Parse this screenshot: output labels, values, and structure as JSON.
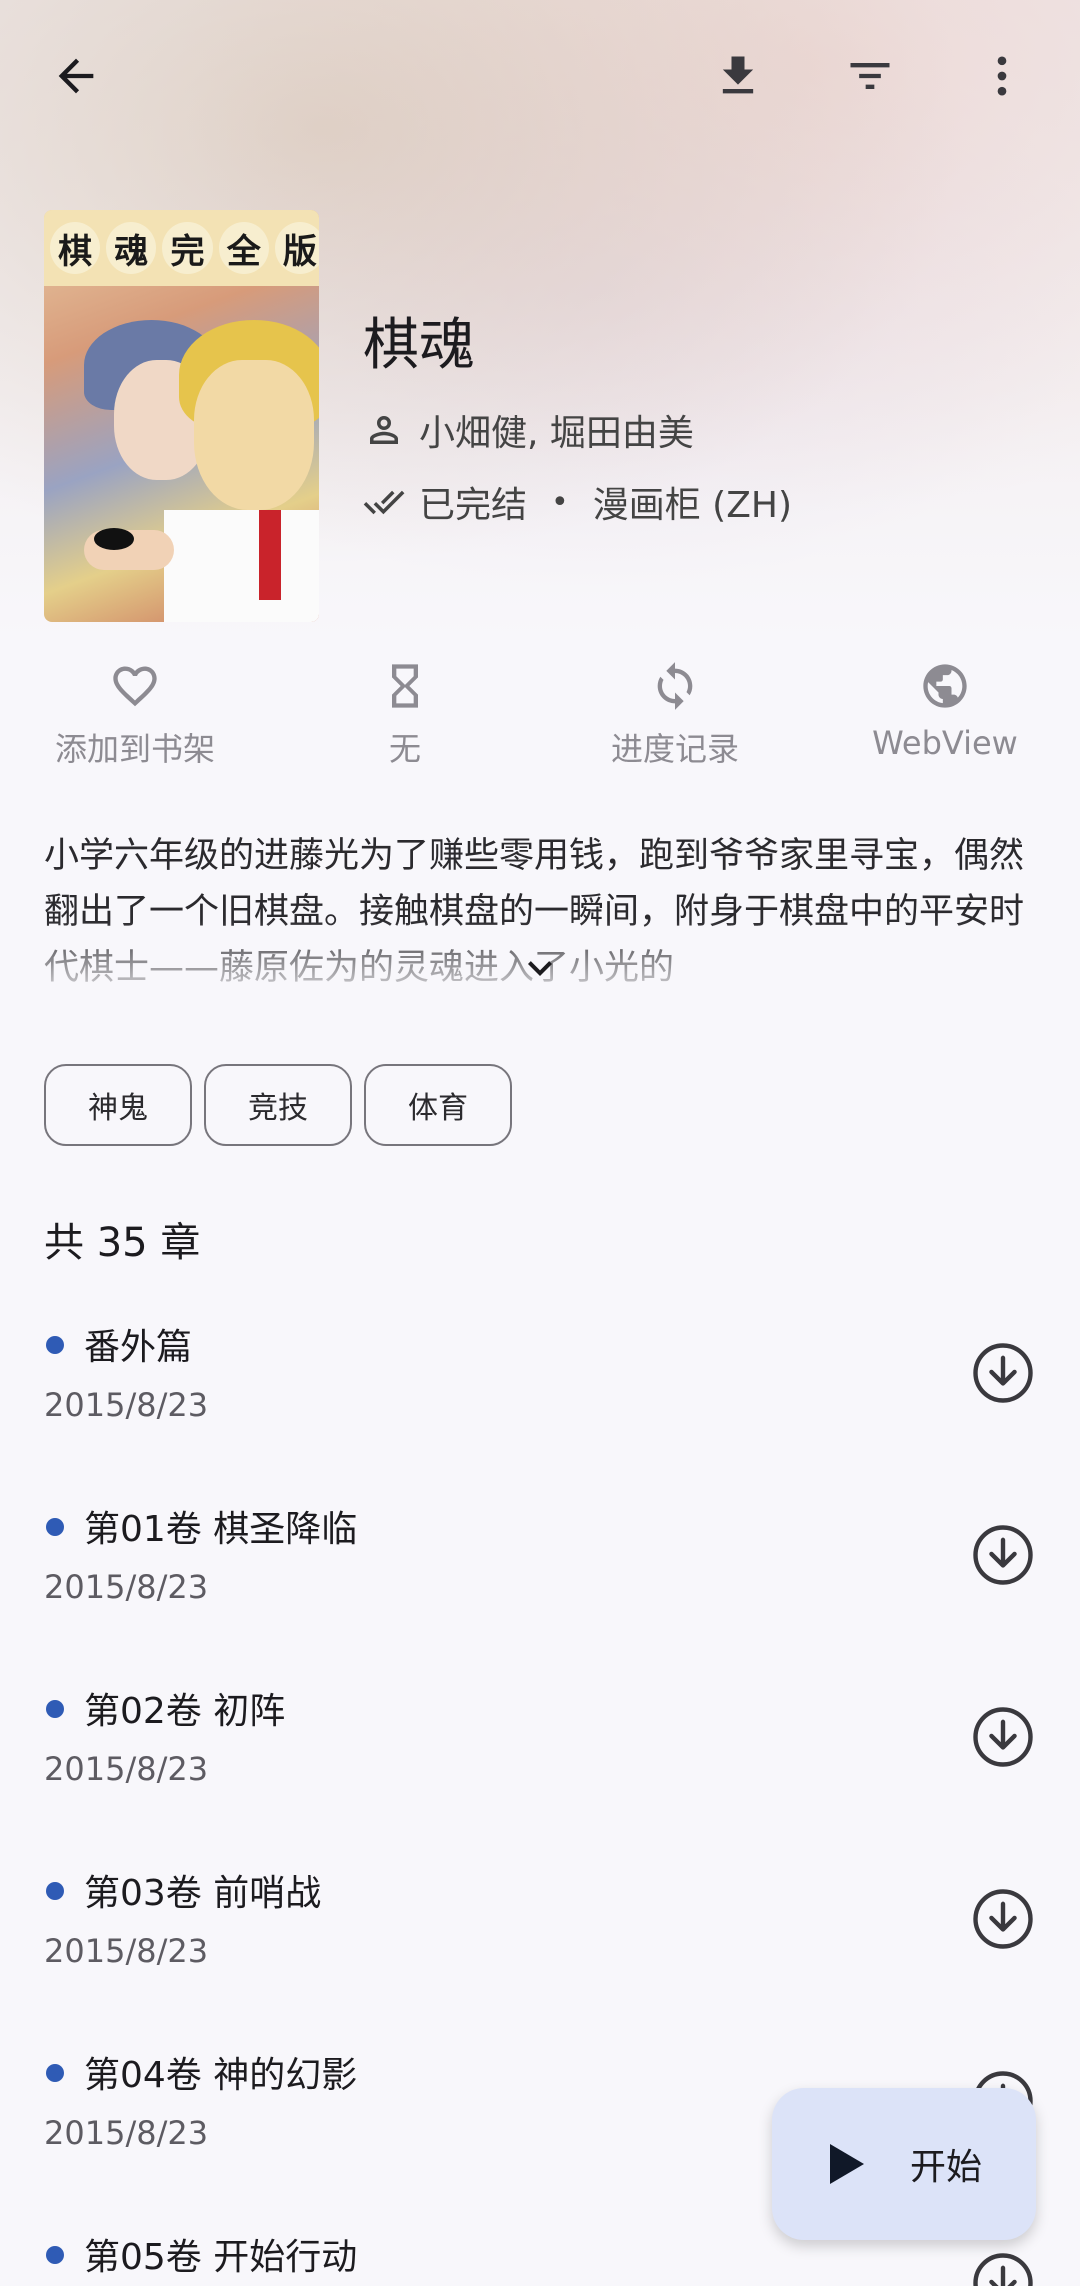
{
  "header": {
    "back_icon": "arrow-back-icon",
    "download_icon": "download-icon",
    "filter_icon": "filter-icon",
    "more_icon": "more-vert-icon"
  },
  "manga": {
    "title": "棋魂",
    "author": "小畑健, 堀田由美",
    "status": "已完结",
    "source": "漫画柜 (ZH)",
    "cover_title_chars": [
      "棋",
      "魂",
      "完",
      "全",
      "版"
    ]
  },
  "actions": [
    {
      "icon": "heart-icon",
      "label": "添加到书架"
    },
    {
      "icon": "hourglass-icon",
      "label": "无"
    },
    {
      "icon": "sync-icon",
      "label": "进度记录"
    },
    {
      "icon": "globe-icon",
      "label": "WebView"
    }
  ],
  "description": "小学六年级的进藤光为了赚些零用钱，跑到爷爷家里寻宝，偶然翻出了一个旧棋盘。接触棋盘的一瞬间，附身于棋盘中的平安时代棋士——藤原佐为的灵魂进入了小光的",
  "tags": [
    "神鬼",
    "竞技",
    "体育"
  ],
  "chapter_count": "共 35 章",
  "chapters": [
    {
      "name": "番外篇",
      "date": "2015/8/23"
    },
    {
      "name": "第01卷 棋圣降临",
      "date": "2015/8/23"
    },
    {
      "name": "第02卷 初阵",
      "date": "2015/8/23"
    },
    {
      "name": "第03卷 前哨战",
      "date": "2015/8/23"
    },
    {
      "name": "第04卷 神的幻影",
      "date": "2015/8/23"
    },
    {
      "name": "第05卷 开始行动",
      "date": ""
    }
  ],
  "fab": {
    "label": "开始",
    "icon": "play-icon"
  },
  "colors": {
    "accent": "#2f5bb5",
    "fab_bg": "#dce3f8"
  }
}
